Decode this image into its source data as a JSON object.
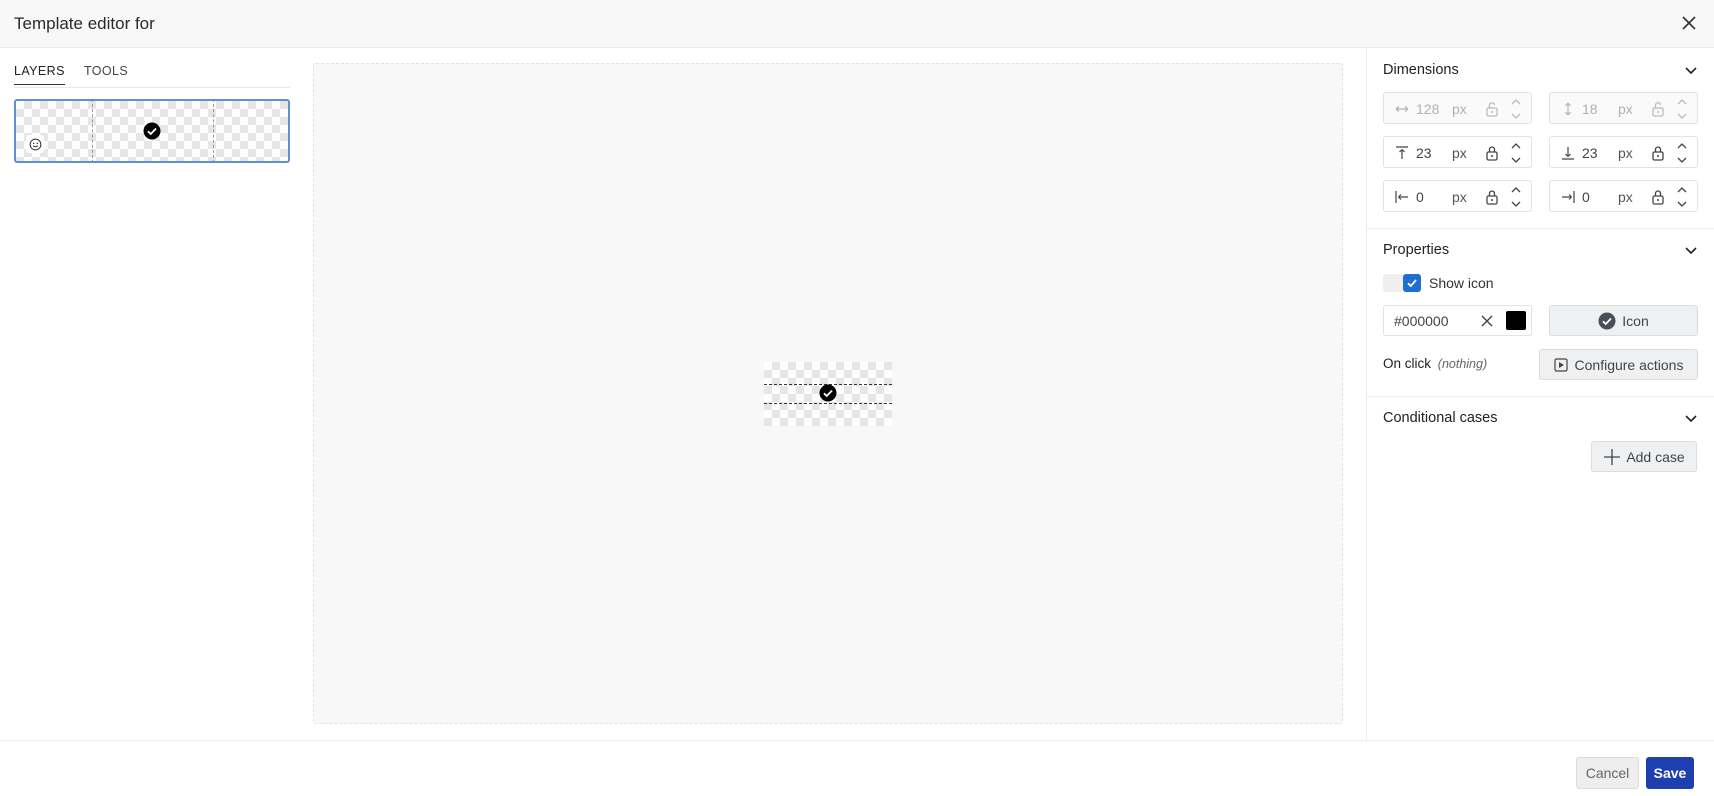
{
  "header": {
    "title": "Template editor for"
  },
  "tabs": [
    {
      "label": "LAYERS",
      "active": true
    },
    {
      "label": "TOOLS",
      "active": false
    }
  ],
  "dimensions": {
    "title": "Dimensions",
    "width": {
      "value": "128",
      "unit": "px",
      "disabled": true
    },
    "height": {
      "value": "18",
      "unit": "px",
      "disabled": true
    },
    "margin_top": {
      "value": "23",
      "unit": "px"
    },
    "margin_bottom": {
      "value": "23",
      "unit": "px"
    },
    "margin_left": {
      "value": "0",
      "unit": "px"
    },
    "margin_right": {
      "value": "0",
      "unit": "px"
    }
  },
  "properties": {
    "title": "Properties",
    "show_icon_label": "Show icon",
    "show_icon_checked": true,
    "color_value": "#000000",
    "color_swatch": "#000000",
    "icon_button_label": "Icon",
    "on_click_label": "On click",
    "on_click_value": "(nothing)",
    "configure_actions_label": "Configure actions"
  },
  "conditional": {
    "title": "Conditional cases",
    "add_case_label": "Add case"
  },
  "footer": {
    "cancel_label": "Cancel",
    "save_label": "Save"
  },
  "colors": {
    "accent": "#1f6ed4",
    "save": "#1e3fb0",
    "selection": "#5c8fd6"
  }
}
